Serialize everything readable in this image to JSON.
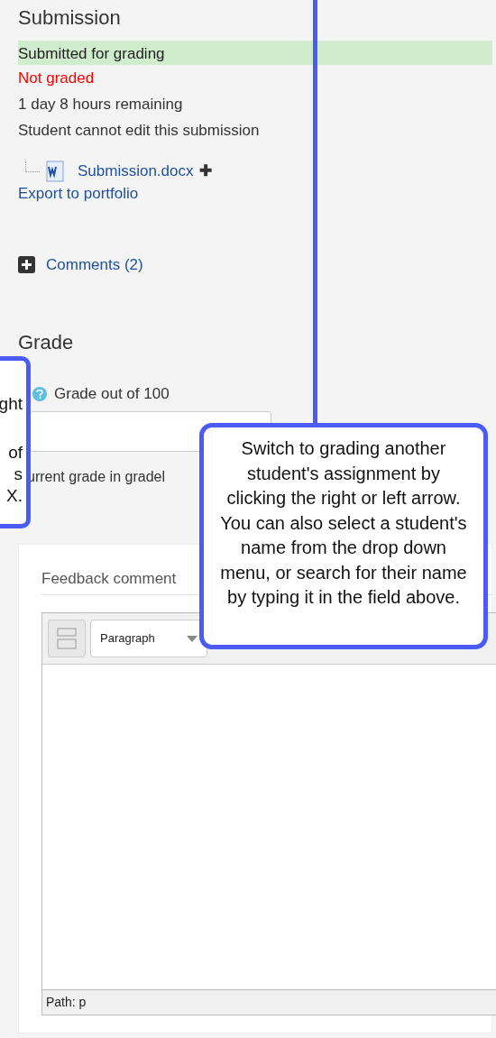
{
  "submission": {
    "heading": "Submission",
    "statuses": [
      {
        "text": "Submitted for grading",
        "kind": "success"
      },
      {
        "text": "Not graded",
        "kind": "warning"
      },
      {
        "text": "1 day 8 hours remaining",
        "kind": "plain"
      },
      {
        "text": "Student cannot edit this submission",
        "kind": "plain"
      }
    ],
    "file": {
      "name": "Submission.docx",
      "plus": "✚"
    },
    "export_link": "Export to portfolio",
    "comments": {
      "label": "Comments (2)",
      "expanded": false
    }
  },
  "grade": {
    "heading": "Grade",
    "label": "Grade out of 100",
    "current_grade_text": "urrent grade in gradel"
  },
  "feedback": {
    "label": "Feedback comment",
    "format_select": "Paragraph",
    "path": "Path: p"
  },
  "left_callout": {
    "lines": [
      "ght",
      "of",
      "s",
      "X."
    ]
  },
  "right_callout": {
    "text": "Switch to grading another student's assignment by clicking the right or left arrow. You can also select a student's name from the drop down menu, or search for their name by typing it in the field above."
  }
}
